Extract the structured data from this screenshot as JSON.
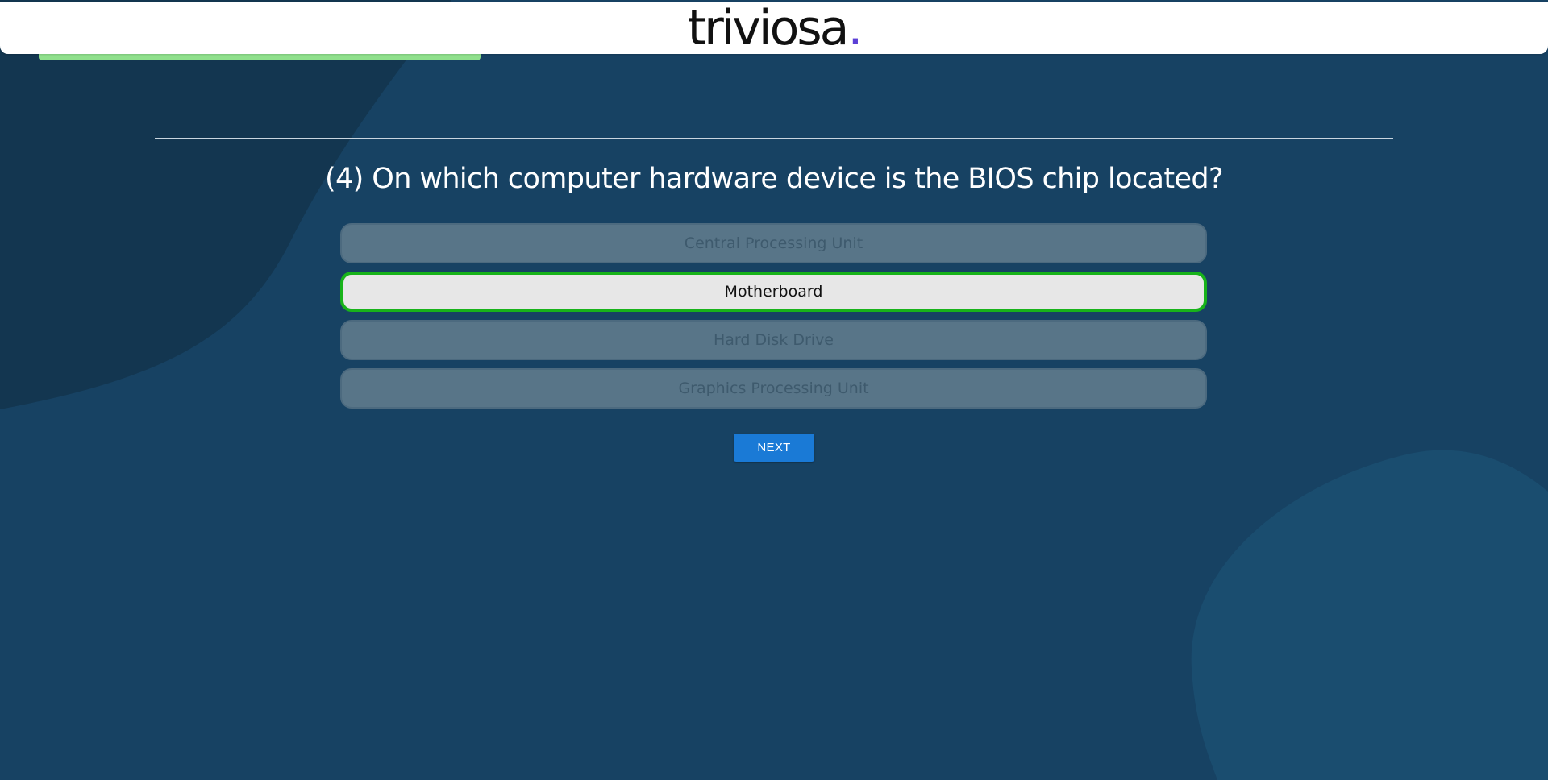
{
  "header": {
    "logo_text": "triviosa",
    "logo_dot": ".",
    "logo_dot_color": "#5b3fd6"
  },
  "progress": {
    "fraction": 0.28,
    "color": "#8fe08c"
  },
  "quiz": {
    "question": "(4) On which computer hardware device is the BIOS chip located?",
    "options": [
      {
        "label": "Central Processing Unit",
        "state": "disabled"
      },
      {
        "label": "Motherboard",
        "state": "selected-correct"
      },
      {
        "label": "Hard Disk Drive",
        "state": "disabled"
      },
      {
        "label": "Graphics Processing Unit",
        "state": "disabled"
      }
    ],
    "next_label": "NEXT"
  },
  "colors": {
    "background": "#174263",
    "correct_border": "#18b31a",
    "next_button": "#1a7ad6"
  }
}
